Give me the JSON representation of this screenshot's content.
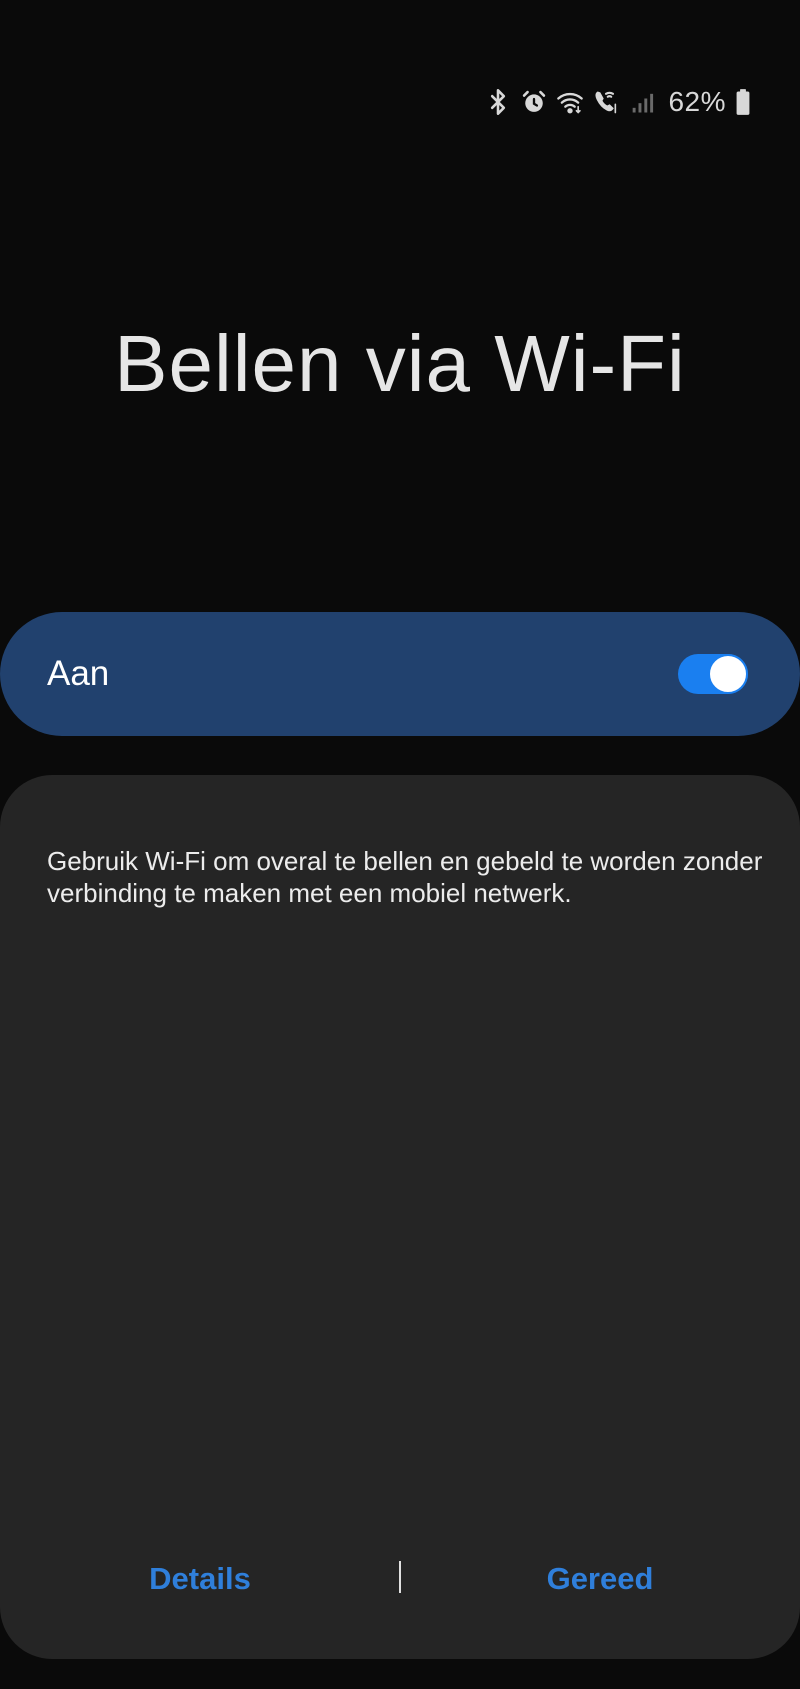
{
  "status_bar": {
    "icons": [
      "bluetooth-icon",
      "alarm-icon",
      "wifi-icon",
      "wifi-calling-icon",
      "signal-icon",
      "battery-icon"
    ],
    "battery_level": "62%"
  },
  "page": {
    "title": "Bellen via Wi-Fi"
  },
  "master_switch": {
    "label": "Aan",
    "state": "on",
    "track_color": "#1a7ff0",
    "bar_color": "#21416e"
  },
  "content": {
    "description": "Gebruik Wi-Fi om overal te bellen en gebeld te worden zonder verbinding te maken met een mobiel netwerk."
  },
  "footer": {
    "details_label": "Details",
    "done_label": "Gereed",
    "accent_color": "#2f7fdb"
  }
}
